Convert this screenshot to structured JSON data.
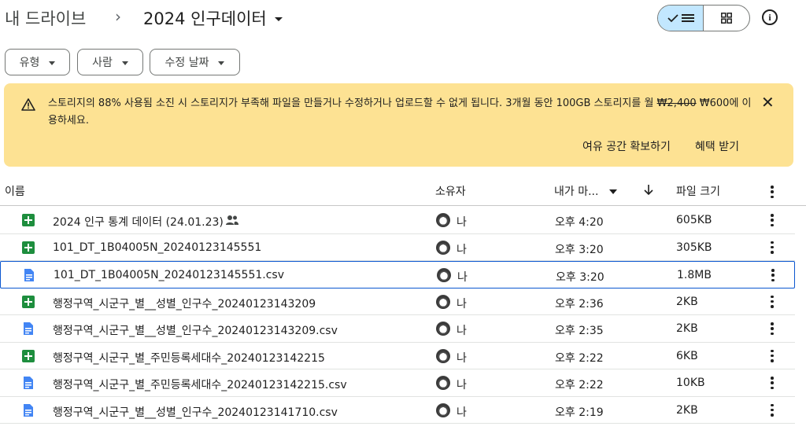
{
  "breadcrumb": {
    "root": "내 드라이브",
    "separator": "›",
    "current": "2024 인구데이터"
  },
  "filters": [
    {
      "label": "유형"
    },
    {
      "label": "사람"
    },
    {
      "label": "수정 날짜"
    }
  ],
  "banner": {
    "text_pre": "스토리지의 88% 사용됨 소진 시 스토리지가 부족해 파일을 만들거나 수정하거나 업로드할 수 없게 됩니다. 3개월 동안 100GB 스토리지를 월 ",
    "old_price": "₩2,400",
    "text_post": " ₩600에 이용하세요.",
    "action_free_space": "여유 공간 확보하기",
    "action_get_offer": "혜택 받기"
  },
  "columns": {
    "name": "이름",
    "owner": "소유자",
    "modified": "내가 마...",
    "size": "파일 크기"
  },
  "files": [
    {
      "type": "sheet",
      "name": "2024 인구 통계 데이터 (24.01.23)",
      "shared": true,
      "owner": "나",
      "modified": "오후 4:20",
      "size": "605KB"
    },
    {
      "type": "sheet",
      "name": "101_DT_1B04005N_20240123145551",
      "shared": false,
      "owner": "나",
      "modified": "오후 3:20",
      "size": "305KB"
    },
    {
      "type": "doc",
      "name": "101_DT_1B04005N_20240123145551.csv",
      "shared": false,
      "owner": "나",
      "modified": "오후 3:20",
      "size": "1.8MB",
      "selected": true
    },
    {
      "type": "sheet",
      "name": "행정구역_시군구_별__성별_인구수_20240123143209",
      "shared": false,
      "owner": "나",
      "modified": "오후 2:36",
      "size": "2KB"
    },
    {
      "type": "doc",
      "name": "행정구역_시군구_별__성별_인구수_20240123143209.csv",
      "shared": false,
      "owner": "나",
      "modified": "오후 2:35",
      "size": "2KB"
    },
    {
      "type": "sheet",
      "name": "행정구역_시군구_별_주민등록세대수_20240123142215",
      "shared": false,
      "owner": "나",
      "modified": "오후 2:22",
      "size": "6KB"
    },
    {
      "type": "doc",
      "name": "행정구역_시군구_별_주민등록세대수_20240123142215.csv",
      "shared": false,
      "owner": "나",
      "modified": "오후 2:22",
      "size": "10KB"
    },
    {
      "type": "doc",
      "name": "행정구역_시군구_별__성별_인구수_20240123141710.csv",
      "shared": false,
      "owner": "나",
      "modified": "오후 2:19",
      "size": "2KB"
    }
  ],
  "colors": {
    "sheet_green": "#1e8e3e",
    "doc_blue": "#4285f4",
    "banner_bg": "#fde293",
    "selected_border": "#0b57d0",
    "toggle_active_bg": "#c2e7ff"
  }
}
